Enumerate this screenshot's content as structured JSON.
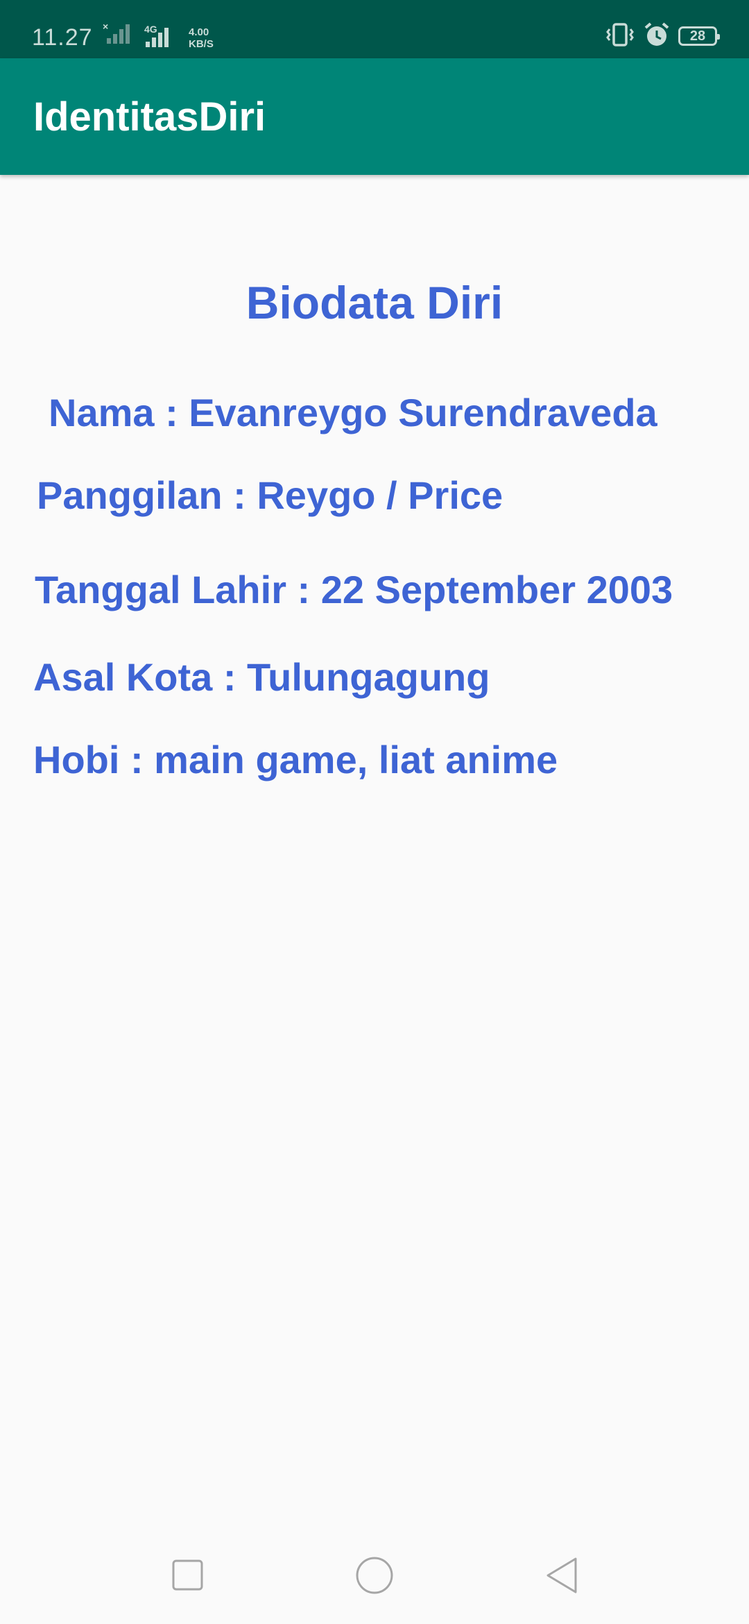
{
  "status_bar": {
    "time": "11.27",
    "network_type": "4G",
    "speed_value": "4.00",
    "speed_unit": "KB/S",
    "battery_level": "28",
    "icons": [
      "signal-no-service-icon",
      "signal-4g-icon",
      "vibrate-icon",
      "alarm-icon",
      "battery-icon"
    ]
  },
  "app_bar": {
    "title": "IdentitasDiri"
  },
  "biodata": {
    "heading": "Biodata Diri",
    "nama": "Nama : Evanreygo Surendraveda",
    "panggilan": "Panggilan : Reygo / Price",
    "tanggal_lahir": "Tanggal Lahir : 22 September 2003",
    "asal_kota": "Asal Kota : Tulungagung",
    "hobi": "Hobi : main game, liat anime"
  },
  "nav_bar": {
    "buttons": [
      "recents-icon",
      "home-icon",
      "back-icon"
    ]
  },
  "colors": {
    "status_bar": "#00574b",
    "app_bar": "#008577",
    "text_accent": "#3e64d4",
    "background": "#fafafa"
  }
}
